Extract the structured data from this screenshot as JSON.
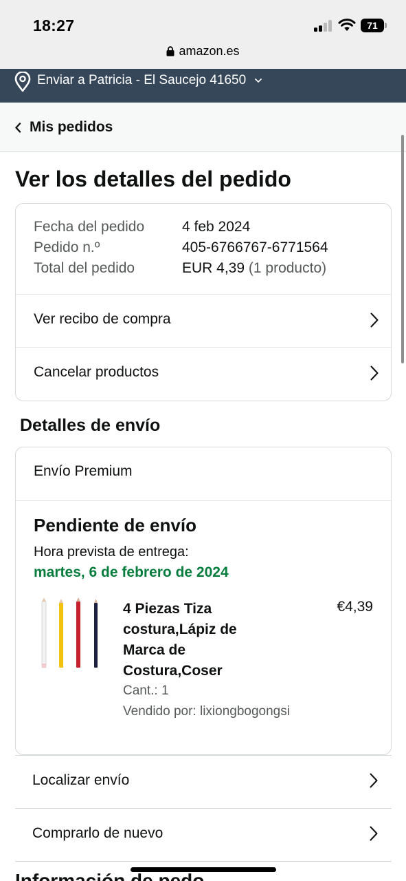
{
  "status_bar": {
    "time": "18:27",
    "battery": "71",
    "url": "amazon.es"
  },
  "delivery": {
    "text": "Enviar a Patricia - El Saucejo 41650"
  },
  "nav": {
    "back_label": "Mis pedidos"
  },
  "page_title": "Ver los detalles del pedido",
  "summary": {
    "rows": [
      {
        "label": "Fecha del pedido",
        "value": "4 feb 2024"
      },
      {
        "label": "Pedido n.º",
        "value": "405-6766767-6771564"
      },
      {
        "label": "Total del pedido",
        "value": "EUR 4,39",
        "extra": "(1 producto)"
      }
    ],
    "links": [
      {
        "label": "Ver recibo de compra"
      },
      {
        "label": "Cancelar productos"
      }
    ]
  },
  "shipping": {
    "section_title": "Detalles de envío",
    "method": "Envío Premium",
    "status": "Pendiente de envío",
    "eta_label": "Hora prevista de entrega:",
    "eta_date": "martes, 6 de febrero de 2024",
    "product": {
      "title": "4 Piezas Tiza costura,Lápiz de Marca de Costura,Coser",
      "price": "€4,39",
      "qty": "Cant.: 1",
      "seller": "Vendido por: lixiongbogongsi",
      "pencil_colors": [
        "#f3f3f3",
        "#f1c20f",
        "#c5202b",
        "#1e2140"
      ]
    }
  },
  "actions": [
    {
      "label": "Localizar envío"
    },
    {
      "label": "Comprarlo de nuevo"
    }
  ],
  "next_section": "Información de pedo",
  "colors": {
    "delivery_bar": "#37475a",
    "eta_green": "#067d3d",
    "muted_text": "#565959"
  }
}
